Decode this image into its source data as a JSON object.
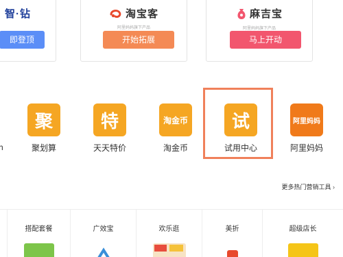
{
  "partners": [
    {
      "logo": "智·钻",
      "subtitle": "",
      "button": "即登顶",
      "button_color": "#5b8ef7"
    },
    {
      "logo": "淘宝客",
      "subtitle": "阿里妈妈旗下产品",
      "button": "开始拓展",
      "button_color": "#f48a55"
    },
    {
      "logo": "麻吉宝",
      "subtitle": "阿里妈妈旗下产品",
      "button": "马上开动",
      "button_color": "#f2566e"
    }
  ],
  "tools": [
    {
      "glyph": "聚",
      "label": "聚划算",
      "color": "#f5a623"
    },
    {
      "glyph": "特",
      "label": "天天特价",
      "color": "#f5a623"
    },
    {
      "glyph": "淘金币",
      "label": "淘金币",
      "color": "#f5a623"
    },
    {
      "glyph": "试",
      "label": "试用中心",
      "color": "#f5a623"
    },
    {
      "glyph": "阿里妈妈",
      "label": "阿里妈妈",
      "color": "#f07a1a"
    }
  ],
  "partial_tool_label": "h",
  "more_link": "更多热门营销工具",
  "more_arrow": "›",
  "products": [
    {
      "label": ""
    },
    {
      "label": "搭配套餐"
    },
    {
      "label": "广效宝"
    },
    {
      "label": "欢乐逛"
    },
    {
      "label": "美折"
    },
    {
      "label": "超级店长"
    }
  ]
}
